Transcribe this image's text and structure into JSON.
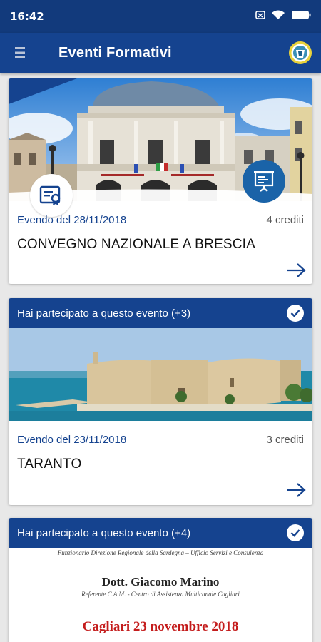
{
  "status": {
    "time": "16:42"
  },
  "header": {
    "title": "Eventi Formativi"
  },
  "colors": {
    "primary": "#15438f",
    "status_bar": "#123a7c",
    "background": "#e8e8e8"
  },
  "events": [
    {
      "banner": "",
      "date": "Evendo del 28/11/2018",
      "credits": "4 crediti",
      "title": "CONVEGNO NAZIONALE A BRESCIA",
      "icons": [
        "certificate-icon",
        "presentation-icon"
      ]
    },
    {
      "banner": "Hai partecipato a questo evento (+3)",
      "date": "Evendo del 23/11/2018",
      "credits": "3 crediti",
      "title": "TARANTO"
    },
    {
      "banner": "Hai partecipato a questo evento (+4)",
      "document": {
        "line1": "Funzionario Direzione Regionale della Sardegna – Ufficio Servizi e Consulenza",
        "name": "Dott. Giacomo Marino",
        "role": "Referente C.A.M. - Centro di Assistenza Multicanale Cagliari",
        "place_date": "Cagliari 23 novembre 2018"
      }
    }
  ]
}
